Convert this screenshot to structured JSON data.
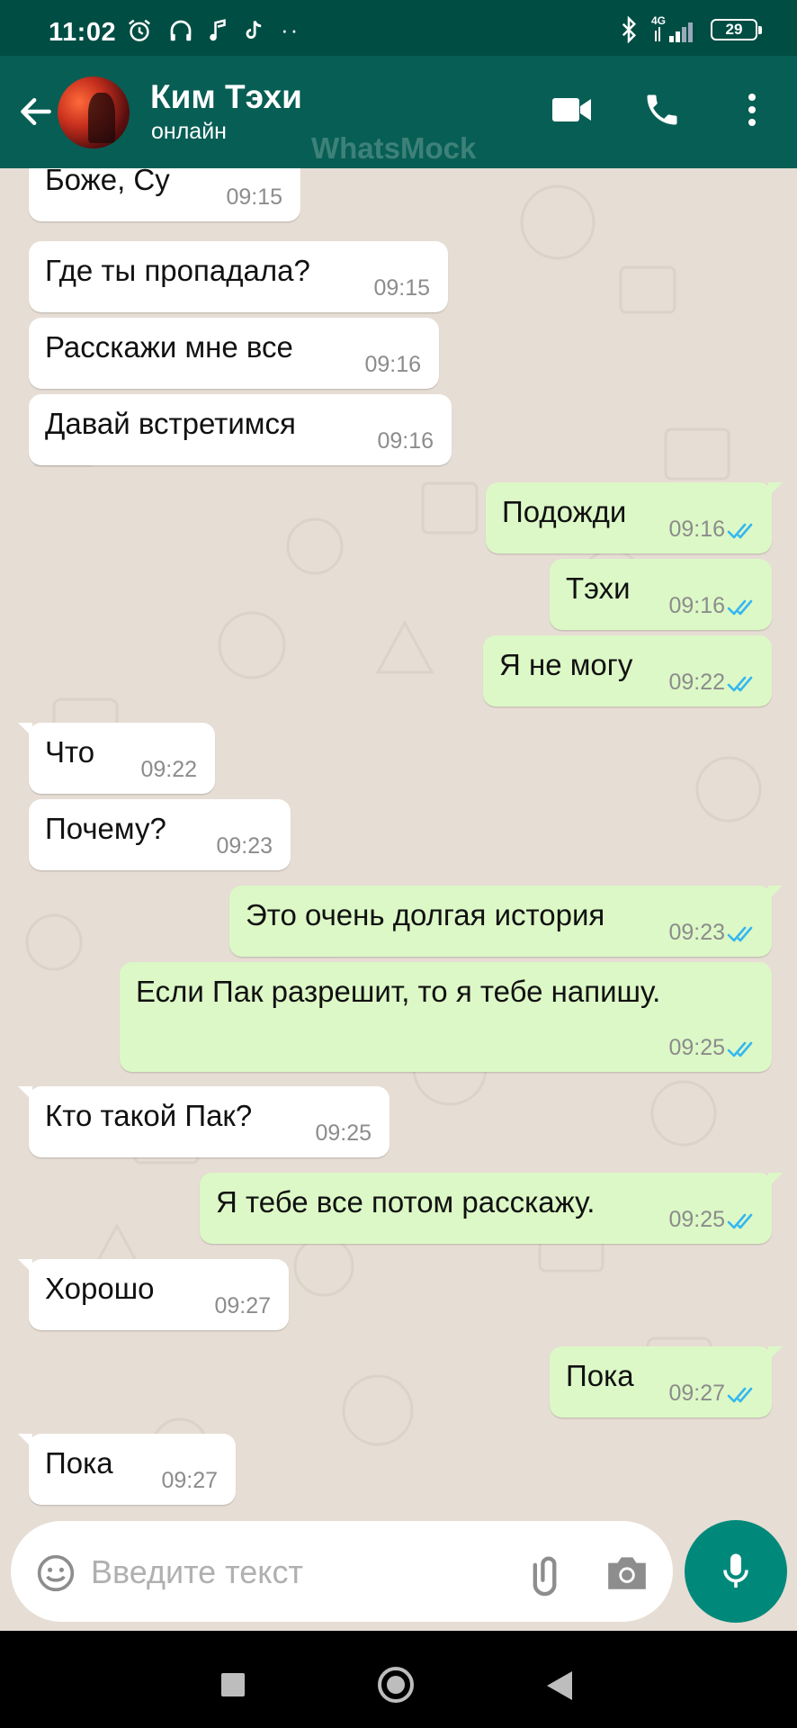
{
  "status_bar": {
    "time": "11:02",
    "network": "4G",
    "battery": "29"
  },
  "header": {
    "contact_name": "Ким Тэхи",
    "status": "онлайн",
    "watermark": "WhatsMock"
  },
  "messages": [
    {
      "dir": "in",
      "text": "Боже, Су",
      "time": "09:15"
    },
    {
      "dir": "in",
      "text": "Где ты пропадала?",
      "time": "09:15"
    },
    {
      "dir": "in",
      "text": "Расскажи мне все",
      "time": "09:16"
    },
    {
      "dir": "in",
      "text": "Давай встретимся",
      "time": "09:16"
    },
    {
      "dir": "out",
      "text": "Подожди",
      "time": "09:16"
    },
    {
      "dir": "out",
      "text": "Тэхи",
      "time": "09:16"
    },
    {
      "dir": "out",
      "text": "Я не могу",
      "time": "09:22"
    },
    {
      "dir": "in",
      "text": "Что",
      "time": "09:22"
    },
    {
      "dir": "in",
      "text": "Почему?",
      "time": "09:23"
    },
    {
      "dir": "out",
      "text": "Это очень долгая история",
      "time": "09:23"
    },
    {
      "dir": "out",
      "text": "Если Пак разрешит, то я тебе напишу.",
      "time": "09:25"
    },
    {
      "dir": "in",
      "text": "Кто такой Пак?",
      "time": "09:25"
    },
    {
      "dir": "out",
      "text": "Я тебе все потом расскажу.",
      "time": "09:25"
    },
    {
      "dir": "in",
      "text": "Хорошо",
      "time": "09:27"
    },
    {
      "dir": "out",
      "text": "Пока",
      "time": "09:27"
    },
    {
      "dir": "in",
      "text": "Пока",
      "time": "09:27"
    }
  ],
  "input": {
    "placeholder": "Введите текст"
  },
  "icons": {
    "back": "arrow-left-icon",
    "video": "video-call-icon",
    "call": "phone-icon",
    "menu": "more-vert-icon",
    "emoji": "emoji-icon",
    "attach": "paperclip-icon",
    "camera": "camera-icon",
    "mic": "microphone-icon",
    "read": "double-check-icon"
  },
  "colors": {
    "status_bar": "#004d43",
    "app_bar": "#075e54",
    "chat_bg": "#e6ddd4",
    "incoming": "#ffffff",
    "outgoing": "#dcf8c6",
    "ticks": "#34b7f1",
    "mic_button": "#00897b"
  }
}
